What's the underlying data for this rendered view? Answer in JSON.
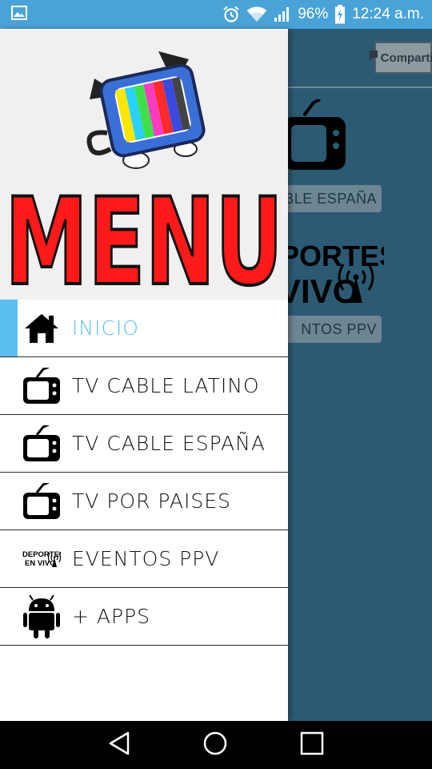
{
  "status_bar": {
    "battery": "96%",
    "time": "12:24 a.m."
  },
  "background_app": {
    "share_label": "Compartir",
    "labels": [
      "BLE ESPAÑA",
      "NTOS PPV"
    ],
    "deportes_text": [
      "PORTES",
      "VIVO"
    ]
  },
  "drawer": {
    "header_title": "MENU",
    "items": [
      {
        "label": "INICIO",
        "icon": "home-icon",
        "active": true
      },
      {
        "label": "TV CABLE LATINO",
        "icon": "tv-icon",
        "active": false
      },
      {
        "label": "TV CABLE ESPAÑA",
        "icon": "tv-icon",
        "active": false
      },
      {
        "label": "TV POR PAISES",
        "icon": "tv-icon",
        "active": false
      },
      {
        "label": "EVENTOS PPV",
        "icon": "deportes-en-vivo-icon",
        "active": false
      },
      {
        "label": "+ APPS",
        "icon": "android-icon",
        "active": false
      }
    ],
    "deportes_icon_text": [
      "DEPORTES",
      "EN VIVO"
    ]
  },
  "colors": {
    "status_bar": "#4aa3d6",
    "accent": "#5bc0f0",
    "menu_red": "#ff1a1a",
    "background_app": "#2c5a73"
  }
}
